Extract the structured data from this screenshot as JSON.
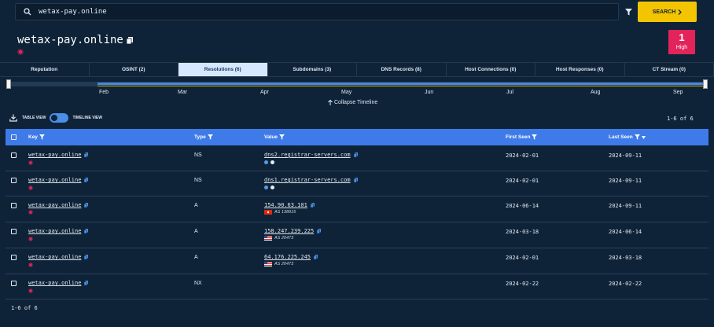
{
  "search": {
    "value": "wetax-pay.online",
    "button_label": "SEARCH"
  },
  "header": {
    "title": "wetax-pay.online",
    "score": "1",
    "score_level": "High"
  },
  "tabs": [
    {
      "label": "Reputation"
    },
    {
      "label": "OSINT (2)"
    },
    {
      "label": "Resolutions (6)"
    },
    {
      "label": "Subdomains (3)"
    },
    {
      "label": "DNS Records (8)"
    },
    {
      "label": "Host Connections (0)"
    },
    {
      "label": "Host Responses (0)"
    },
    {
      "label": "CT Stream (0)"
    }
  ],
  "timeline": {
    "months": [
      "Feb",
      "Mar",
      "Apr",
      "May",
      "Jun",
      "Jul",
      "Aug",
      "Sep"
    ],
    "collapse_label": "Collapse Timeline"
  },
  "view": {
    "table_label": "TABLE VIEW",
    "timeline_label": "TIMELINE VIEW"
  },
  "pagination": {
    "top": "1-6 of 6",
    "bottom": "1-6 of 6"
  },
  "table": {
    "columns": [
      "Key",
      "Type",
      "Value",
      "First Seen",
      "Last Seen"
    ],
    "rows": [
      {
        "key": "wetax-pay.online",
        "type": "NS",
        "value": "dns2.registrar-servers.com",
        "sub": "",
        "first_seen": "2024-02-01",
        "last_seen": "2024-09-11"
      },
      {
        "key": "wetax-pay.online",
        "type": "NS",
        "value": "dns1.registrar-servers.com",
        "sub": "",
        "first_seen": "2024-02-01",
        "last_seen": "2024-09-11"
      },
      {
        "key": "wetax-pay.online",
        "type": "A",
        "value": "154.90.63.101",
        "sub": "AS 138915",
        "first_seen": "2024-06-14",
        "last_seen": "2024-09-11"
      },
      {
        "key": "wetax-pay.online",
        "type": "A",
        "value": "158.247.239.225",
        "sub": "AS 20473",
        "first_seen": "2024-03-18",
        "last_seen": "2024-06-14"
      },
      {
        "key": "wetax-pay.online",
        "type": "A",
        "value": "64.176.225.245",
        "sub": "AS 20473",
        "first_seen": "2024-02-01",
        "last_seen": "2024-03-18"
      },
      {
        "key": "wetax-pay.online",
        "type": "NX",
        "value": "",
        "sub": "",
        "first_seen": "2024-02-22",
        "last_seen": "2024-02-22"
      }
    ]
  },
  "colors": {
    "background": "#0f2338",
    "accent_blue": "#3e7be8",
    "search_yellow": "#f2c500",
    "score_red": "#e3245a"
  }
}
